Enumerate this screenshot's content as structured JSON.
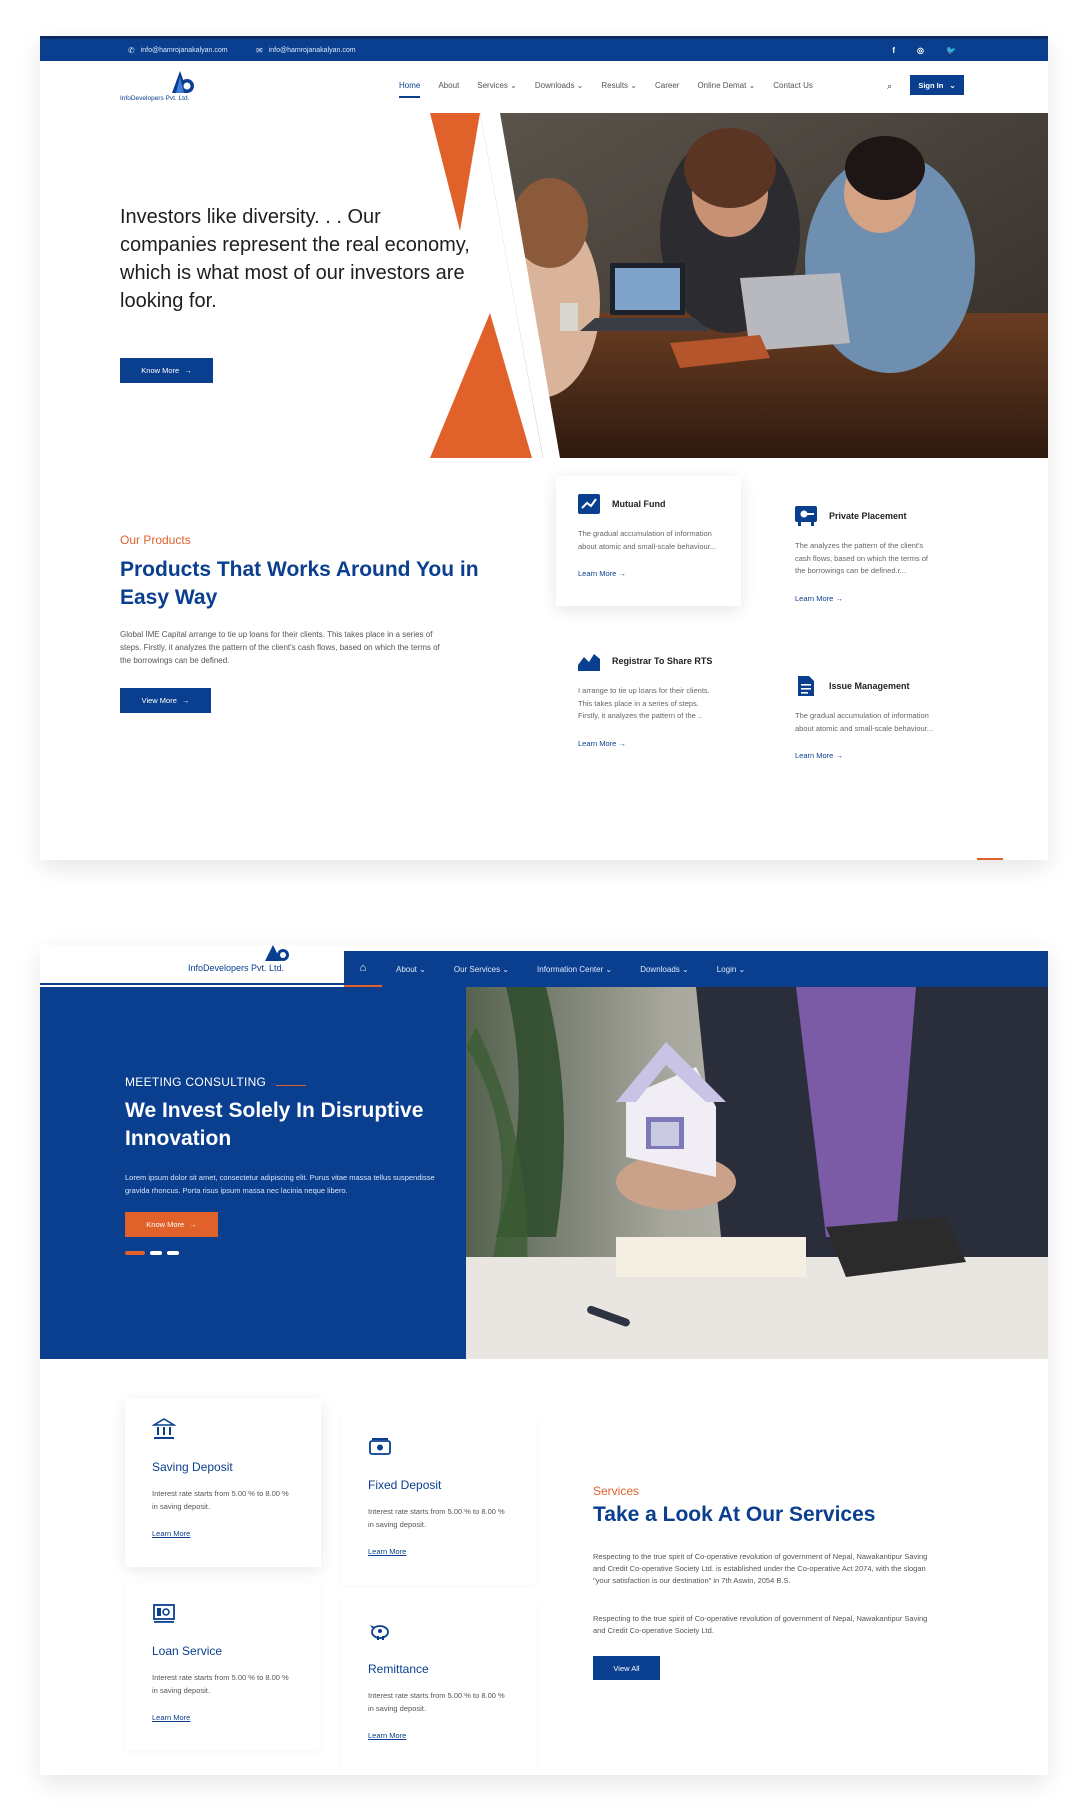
{
  "site1": {
    "topbar": {
      "email1": "info@hamrojanakalyan.com",
      "email2": "info@hamrojanakalyan.com",
      "social": [
        "f",
        "◎",
        "🐦"
      ]
    },
    "logo_text": "InfoDevelopers Pvt. Ltd.",
    "nav": [
      {
        "label": "Home"
      },
      {
        "label": "About"
      },
      {
        "label": "Services ⌄"
      },
      {
        "label": "Downloads ⌄"
      },
      {
        "label": "Results ⌄"
      },
      {
        "label": "Career"
      },
      {
        "label": "Online Demat ⌄"
      },
      {
        "label": "Contact Us"
      }
    ],
    "signin": "Sign In",
    "hero": {
      "headline": "Investors like diversity. . . Our companies represent the real economy, which is what most of our investors are looking for.",
      "cta": "Know More"
    },
    "products": {
      "eyebrow": "Our Products",
      "title": "Products That Works Around You in Easy Way",
      "desc": "Global IME Capital arrange to tie up loans for their clients. This takes place in a series of steps. Firstly, it analyzes the pattern of the client's cash flows, based on which the terms of the borrowings can be defined.",
      "cta": "View More",
      "cards": [
        {
          "title": "Mutual Fund",
          "text": "The gradual accumulation of information about atomic and small-scale behaviour...",
          "link": "Learn More"
        },
        {
          "title": "Private Placement",
          "text": "The analyzes the pattern of the client's cash flows, based on which the terms of the borrowings can be defined.r...",
          "link": "Learn More"
        },
        {
          "title": "Registrar To Share RTS",
          "text": "I arrange to tie up loans for their clients. This takes place in a series of steps. Firstly, it analyzes the pattern of the ..",
          "link": "Learn More"
        },
        {
          "title": "Issue Management",
          "text": "The gradual accumulation of information about atomic and small-scale behaviour...",
          "link": "Learn More"
        }
      ]
    }
  },
  "site2": {
    "logo_text": "InfoDevelopers Pvt. Ltd.",
    "nav": [
      {
        "label": "About ⌄"
      },
      {
        "label": "Our Services ⌄"
      },
      {
        "label": "Information Center ⌄"
      },
      {
        "label": "Downloads ⌄"
      },
      {
        "label": "Login ⌄"
      }
    ],
    "hero": {
      "eyebrow": "MEETING  CONSULTING",
      "title": "We Invest Solely In Disruptive Innovation",
      "lead": "Lorem ipsum dolor sit amet, consectetur adipiscing elit. Purus vitae massa tellus suspendisse gravida rhoncus. Porta risus ipsum massa nec lacinia neque libero.",
      "cta": "Know More"
    },
    "services": {
      "eyebrow": "Services",
      "title": "Take a Look At Our Services",
      "p1": "Respecting to the true spirit of Co-operative revolution of government of Nepal, Nawakantipur Saving and Credit Co-operative Society Ltd. is established under the Co-operative Act 2074, with the slogan \"your satisfaction is our destination\" in 7th Aswin, 2054 B.S.",
      "p2": "Respecting to the true spirit of Co-operative revolution of government of Nepal, Nawakantipur Saving and Credit Co-operative Society Ltd.",
      "cta": "View All",
      "cards": [
        {
          "title": "Saving Deposit",
          "text": "Interest rate starts from 5.00 % to 8.00 % in saving deposit.",
          "link": "Learn More"
        },
        {
          "title": "Fixed Deposit",
          "text": "Interest rate starts from 5.00 % to 8.00 % in saving deposit.",
          "link": "Learn More"
        },
        {
          "title": "Loan Service",
          "text": "Interest rate starts from 5.00 % to 8.00 % in saving deposit.",
          "link": "Learn More"
        },
        {
          "title": "Remittance",
          "text": "Interest rate starts from 5.00 % to 8.00 % in saving deposit.",
          "link": "Learn More"
        }
      ]
    }
  },
  "colors": {
    "primary": "#0a3f8f",
    "accent": "#e0612a"
  }
}
